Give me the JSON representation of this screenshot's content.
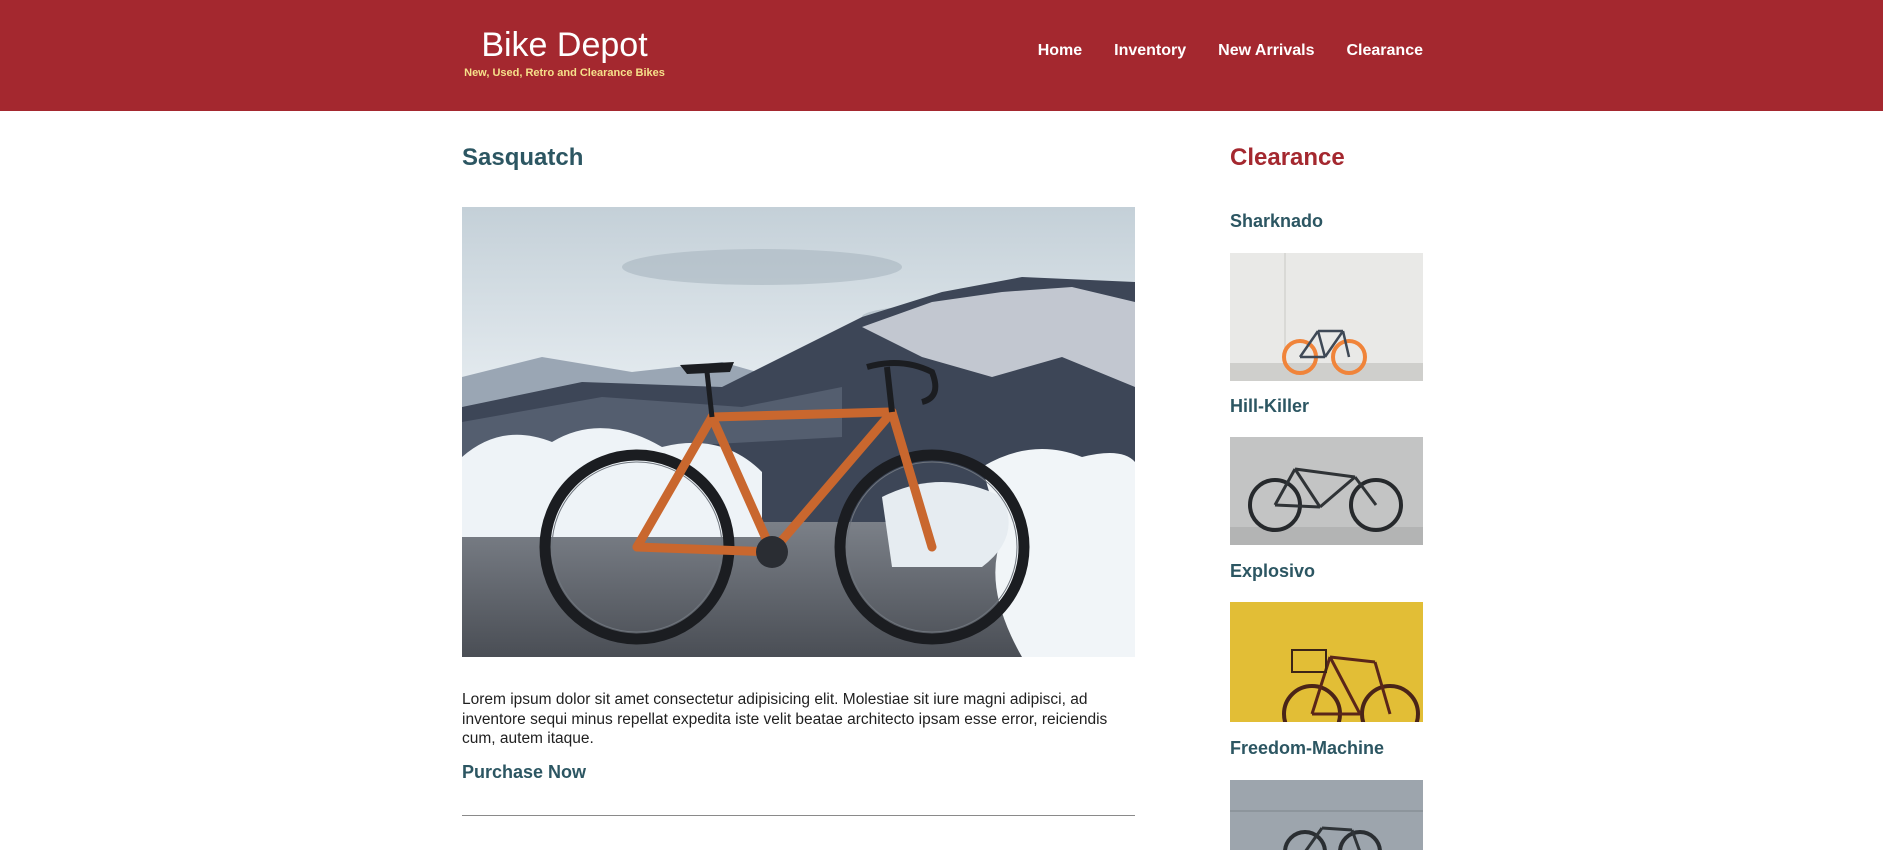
{
  "brand": {
    "title": "Bike Depot",
    "tagline": "New, Used, Retro and Clearance Bikes"
  },
  "nav": {
    "items": [
      "Home",
      "Inventory",
      "New Arrivals",
      "Clearance"
    ]
  },
  "main": {
    "title": "Sasquatch",
    "image_icon": "bike-photo",
    "description": "Lorem ipsum dolor sit amet consectetur adipisicing elit. Molestiae sit iure magni adipisci, ad inventore sequi minus repellat expedita iste velit beatae architecto ipsam esse error, reiciendis cum, autem itaque.",
    "purchase_label": "Purchase Now"
  },
  "sidebar": {
    "title": "Clearance",
    "items": [
      {
        "label": "Sharknado"
      },
      {
        "label": "Hill-Killer"
      },
      {
        "label": "Explosivo"
      },
      {
        "label": "Freedom-Machine"
      }
    ]
  },
  "colors": {
    "header": "#a4282f",
    "accent_text": "#2c5662",
    "tagline": "#f6e08a"
  }
}
